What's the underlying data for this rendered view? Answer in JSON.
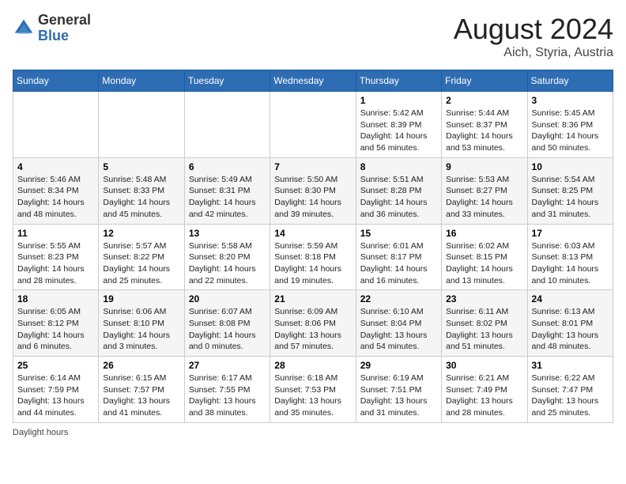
{
  "header": {
    "logo_general": "General",
    "logo_blue": "Blue",
    "month_year": "August 2024",
    "location": "Aich, Styria, Austria"
  },
  "days_of_week": [
    "Sunday",
    "Monday",
    "Tuesday",
    "Wednesday",
    "Thursday",
    "Friday",
    "Saturday"
  ],
  "weeks": [
    [
      {
        "day": "",
        "info": ""
      },
      {
        "day": "",
        "info": ""
      },
      {
        "day": "",
        "info": ""
      },
      {
        "day": "",
        "info": ""
      },
      {
        "day": "1",
        "info": "Sunrise: 5:42 AM\nSunset: 8:39 PM\nDaylight: 14 hours and 56 minutes."
      },
      {
        "day": "2",
        "info": "Sunrise: 5:44 AM\nSunset: 8:37 PM\nDaylight: 14 hours and 53 minutes."
      },
      {
        "day": "3",
        "info": "Sunrise: 5:45 AM\nSunset: 8:36 PM\nDaylight: 14 hours and 50 minutes."
      }
    ],
    [
      {
        "day": "4",
        "info": "Sunrise: 5:46 AM\nSunset: 8:34 PM\nDaylight: 14 hours and 48 minutes."
      },
      {
        "day": "5",
        "info": "Sunrise: 5:48 AM\nSunset: 8:33 PM\nDaylight: 14 hours and 45 minutes."
      },
      {
        "day": "6",
        "info": "Sunrise: 5:49 AM\nSunset: 8:31 PM\nDaylight: 14 hours and 42 minutes."
      },
      {
        "day": "7",
        "info": "Sunrise: 5:50 AM\nSunset: 8:30 PM\nDaylight: 14 hours and 39 minutes."
      },
      {
        "day": "8",
        "info": "Sunrise: 5:51 AM\nSunset: 8:28 PM\nDaylight: 14 hours and 36 minutes."
      },
      {
        "day": "9",
        "info": "Sunrise: 5:53 AM\nSunset: 8:27 PM\nDaylight: 14 hours and 33 minutes."
      },
      {
        "day": "10",
        "info": "Sunrise: 5:54 AM\nSunset: 8:25 PM\nDaylight: 14 hours and 31 minutes."
      }
    ],
    [
      {
        "day": "11",
        "info": "Sunrise: 5:55 AM\nSunset: 8:23 PM\nDaylight: 14 hours and 28 minutes."
      },
      {
        "day": "12",
        "info": "Sunrise: 5:57 AM\nSunset: 8:22 PM\nDaylight: 14 hours and 25 minutes."
      },
      {
        "day": "13",
        "info": "Sunrise: 5:58 AM\nSunset: 8:20 PM\nDaylight: 14 hours and 22 minutes."
      },
      {
        "day": "14",
        "info": "Sunrise: 5:59 AM\nSunset: 8:18 PM\nDaylight: 14 hours and 19 minutes."
      },
      {
        "day": "15",
        "info": "Sunrise: 6:01 AM\nSunset: 8:17 PM\nDaylight: 14 hours and 16 minutes."
      },
      {
        "day": "16",
        "info": "Sunrise: 6:02 AM\nSunset: 8:15 PM\nDaylight: 14 hours and 13 minutes."
      },
      {
        "day": "17",
        "info": "Sunrise: 6:03 AM\nSunset: 8:13 PM\nDaylight: 14 hours and 10 minutes."
      }
    ],
    [
      {
        "day": "18",
        "info": "Sunrise: 6:05 AM\nSunset: 8:12 PM\nDaylight: 14 hours and 6 minutes."
      },
      {
        "day": "19",
        "info": "Sunrise: 6:06 AM\nSunset: 8:10 PM\nDaylight: 14 hours and 3 minutes."
      },
      {
        "day": "20",
        "info": "Sunrise: 6:07 AM\nSunset: 8:08 PM\nDaylight: 14 hours and 0 minutes."
      },
      {
        "day": "21",
        "info": "Sunrise: 6:09 AM\nSunset: 8:06 PM\nDaylight: 13 hours and 57 minutes."
      },
      {
        "day": "22",
        "info": "Sunrise: 6:10 AM\nSunset: 8:04 PM\nDaylight: 13 hours and 54 minutes."
      },
      {
        "day": "23",
        "info": "Sunrise: 6:11 AM\nSunset: 8:02 PM\nDaylight: 13 hours and 51 minutes."
      },
      {
        "day": "24",
        "info": "Sunrise: 6:13 AM\nSunset: 8:01 PM\nDaylight: 13 hours and 48 minutes."
      }
    ],
    [
      {
        "day": "25",
        "info": "Sunrise: 6:14 AM\nSunset: 7:59 PM\nDaylight: 13 hours and 44 minutes."
      },
      {
        "day": "26",
        "info": "Sunrise: 6:15 AM\nSunset: 7:57 PM\nDaylight: 13 hours and 41 minutes."
      },
      {
        "day": "27",
        "info": "Sunrise: 6:17 AM\nSunset: 7:55 PM\nDaylight: 13 hours and 38 minutes."
      },
      {
        "day": "28",
        "info": "Sunrise: 6:18 AM\nSunset: 7:53 PM\nDaylight: 13 hours and 35 minutes."
      },
      {
        "day": "29",
        "info": "Sunrise: 6:19 AM\nSunset: 7:51 PM\nDaylight: 13 hours and 31 minutes."
      },
      {
        "day": "30",
        "info": "Sunrise: 6:21 AM\nSunset: 7:49 PM\nDaylight: 13 hours and 28 minutes."
      },
      {
        "day": "31",
        "info": "Sunrise: 6:22 AM\nSunset: 7:47 PM\nDaylight: 13 hours and 25 minutes."
      }
    ]
  ],
  "footer": {
    "note": "Daylight hours"
  }
}
